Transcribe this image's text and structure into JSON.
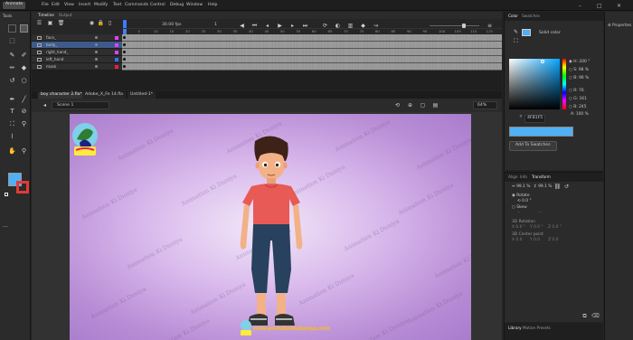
{
  "app": {
    "name": "Animate"
  },
  "menu": [
    "File",
    "Edit",
    "View",
    "Insert",
    "Modify",
    "Text",
    "Commands",
    "Control",
    "Debug",
    "Window",
    "Help"
  ],
  "timeline": {
    "tabs": [
      "Timeline",
      "Output"
    ],
    "fps": "30.00",
    "fps_unit": "fps",
    "frame": "1",
    "ruler": [
      "1",
      "5",
      "10",
      "15",
      "20",
      "25",
      "30",
      "35",
      "40",
      "45",
      "50",
      "55",
      "60",
      "65",
      "70",
      "75",
      "80",
      "85",
      "90",
      "95",
      "100",
      "105",
      "110",
      "115"
    ],
    "layers": [
      {
        "name": "face_",
        "color": "#e040fb",
        "selected": false
      },
      {
        "name": "body_",
        "color": "#e040fb",
        "selected": true
      },
      {
        "name": "right_hand_",
        "color": "#e040fb",
        "selected": false
      },
      {
        "name": "left_hand",
        "color": "#2979ff",
        "selected": false
      },
      {
        "name": "mask",
        "color": "#ff1744",
        "selected": false
      }
    ]
  },
  "doc_tabs": [
    "boy character 2.fla*",
    "Adobe_X_Fe 14.fla",
    "Untitled-1*"
  ],
  "stage": {
    "scene": "Scene 1",
    "zoom": "64%",
    "watermark": "Animation Ki Duniya",
    "website": "www.animationkiduniya.com",
    "logo_text": "Animation Ki Duniya"
  },
  "color_panel": {
    "tabs": [
      "Color",
      "Swatches"
    ],
    "fill_type": "Solid color",
    "hsb": {
      "H": "200 °",
      "S": "98 %",
      "B": "96 %"
    },
    "rgb": {
      "R": "76",
      "G": "161",
      "B": "245"
    },
    "alpha": "100 %",
    "hex": "4FB1F5",
    "swatch_color": "#4fb1f5",
    "add_button": "Add To Swatches"
  },
  "props_panel": {
    "tabs": [
      "Align",
      "Info",
      "Transform"
    ],
    "scale_w": "99.1 %",
    "scale_h": "99.1 %",
    "rotate_label": "Rotate",
    "rotate_value": "0.0 °",
    "skew_label": "Skew",
    "skew_values": [
      "--",
      "--"
    ],
    "rotation3d_label": "3D Rotation",
    "rotation3d": [
      "0.0 °",
      "0.0 °",
      "0.0 °"
    ],
    "center3d_label": "3D Center point",
    "center3d": [
      "0.0",
      "0.0",
      "0.0"
    ],
    "axis_x": "X",
    "axis_y": "Y",
    "axis_z": "Z"
  },
  "library": {
    "tabs": [
      "Library",
      "Motion Presets"
    ]
  },
  "right_column": {
    "label": "Properties"
  },
  "tools_panel": {
    "label": "Tools"
  }
}
